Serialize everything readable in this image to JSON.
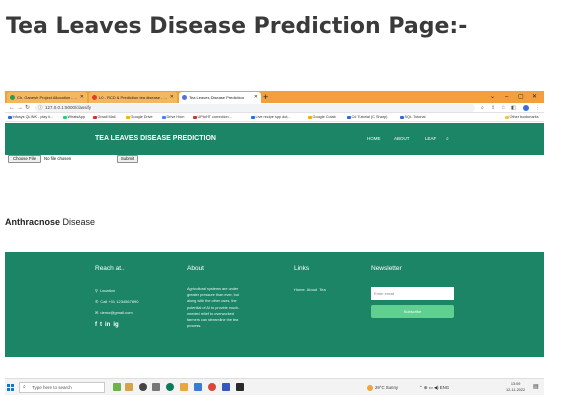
{
  "doc_title": "Tea Leaves Disease Prediction Page:-",
  "browser": {
    "tabs": [
      {
        "label": "Ch. Ganesh Project Allocation - ...",
        "active": false,
        "color": "#2a9d4a"
      },
      {
        "label": "L0 - RCD & Prediction tea disease - ...",
        "active": false,
        "color": "#e0402b"
      },
      {
        "label": "Tea Leaves Disease Prediction",
        "active": true,
        "color": "#5b6fd8"
      }
    ],
    "new_tab": "+",
    "window_controls": [
      "⌄",
      "–",
      "▢",
      "✕"
    ],
    "nav": {
      "back": "←",
      "forward": "→",
      "reload": "↻"
    },
    "url": "127.0.0.1:5000/classify",
    "bookmarks": [
      {
        "label": "Infosys QLINK - play k...",
        "color": "#2f6bd1"
      },
      {
        "label": "WhatsApp",
        "color": "#25d366"
      },
      {
        "label": "Gmail Mail",
        "color": "#d93025"
      },
      {
        "label": "Google Drive",
        "color": "#f4b400"
      },
      {
        "label": "Drive Hom",
        "color": "#4285f4"
      },
      {
        "label": "UPtoHT correction...",
        "color": "#c0392b"
      },
      {
        "label": "Live recipe spp dot...",
        "color": "#1a73e8"
      },
      {
        "label": "Google Colab",
        "color": "#f9ab00"
      },
      {
        "label": "C# Tutorial (C Sharp)",
        "color": "#2f6bd1"
      },
      {
        "label": "SQL Tutorial",
        "color": "#2f6bd1"
      }
    ],
    "other_bookmarks": "Other bookmarks"
  },
  "site": {
    "brand": "TEA LEAVES DISEASE PREDICTION",
    "nav_links": [
      "HOME",
      "ABOUT",
      "LEAF"
    ],
    "choose_file_label": "Choose File",
    "file_status": "No file chosen",
    "submit_label": "Submit",
    "result": {
      "disease": "Anthracnose",
      "suffix": " Disease"
    }
  },
  "footer": {
    "reach": {
      "heading": "Reach at..",
      "location": "Location",
      "phone": "Call +01 1234567890",
      "email": "demo@gmail.com"
    },
    "about": {
      "heading": "About",
      "text": "Agricultural systems are under greater pressure than ever, but along with the other uses, the potential of AI to provide much-needed relief to overworked farmers can streamline the tea process."
    },
    "links": {
      "heading": "Links",
      "items": "Home  About  Tea"
    },
    "newsletter": {
      "heading": "Newsletter",
      "email_placeholder": "Enter email",
      "subscribe_label": "Subscribe"
    },
    "social_icons": [
      "f",
      "t",
      "in",
      "ig"
    ]
  },
  "taskbar": {
    "search_placeholder": "Type here to search",
    "weather": "29°C Sunny",
    "tray": "⌃ ⊕ ▭ ◀) ENG",
    "time": "13:09",
    "date": "12-11-2022"
  },
  "colors": {
    "site_green": "#1c8565",
    "tab_orange": "#f2a03d",
    "subscribe_green": "#5fd08f"
  }
}
